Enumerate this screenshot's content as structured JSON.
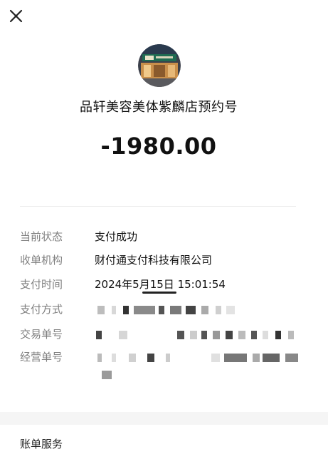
{
  "header": {
    "close_icon": "close-icon",
    "merchant_name": "品轩美容美体紫麟店预约号",
    "amount": "-1980.00"
  },
  "details": [
    {
      "label": "当前状态",
      "value": "支付成功"
    },
    {
      "label": "收单机构",
      "value": "财付通支付科技有限公司"
    },
    {
      "label": "支付时间",
      "value": "2024年5月15日 15:01:54"
    },
    {
      "label": "支付方式",
      "value": ""
    },
    {
      "label": "交易单号",
      "value": ""
    },
    {
      "label": "经营单号",
      "value": ""
    }
  ],
  "bill_service": {
    "title": "账单服务"
  }
}
